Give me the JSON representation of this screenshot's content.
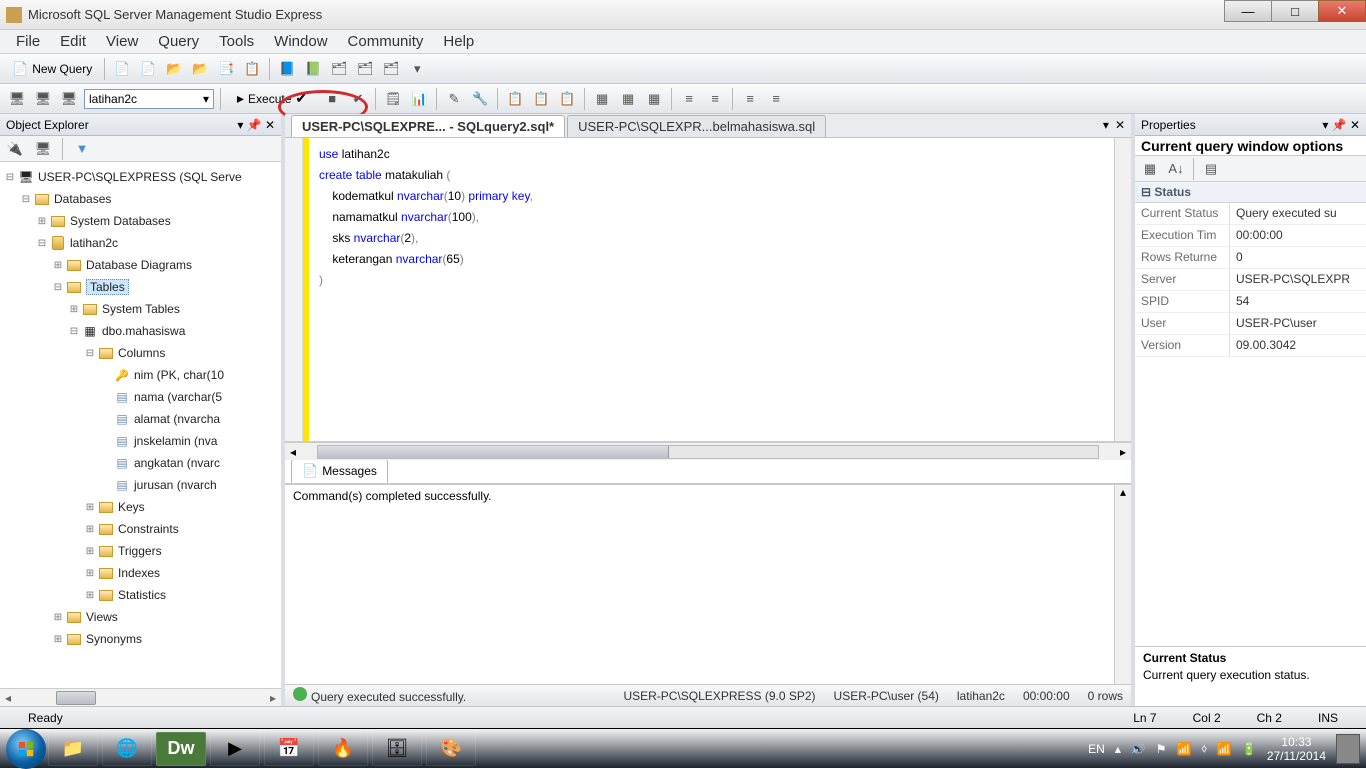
{
  "window": {
    "title": "Microsoft SQL Server Management Studio Express"
  },
  "menu": {
    "file": "File",
    "edit": "Edit",
    "view": "View",
    "query": "Query",
    "tools": "Tools",
    "window": "Window",
    "community": "Community",
    "help": "Help"
  },
  "toolbar1": {
    "newquery": "New Query"
  },
  "toolbar2": {
    "database": "latihan2c",
    "execute": "Execute"
  },
  "explorer": {
    "title": "Object Explorer",
    "server": "USER-PC\\SQLEXPRESS (SQL Serve",
    "nodes": {
      "databases": "Databases",
      "sysdb": "System Databases",
      "db": "latihan2c",
      "diagrams": "Database Diagrams",
      "tables": "Tables",
      "systables": "System Tables",
      "mahasiswa": "dbo.mahasiswa",
      "columns": "Columns",
      "col_nim": "nim (PK, char(10",
      "col_nama": "nama (varchar(5",
      "col_alamat": "alamat (nvarcha",
      "col_jnskelamin": "jnskelamin (nva",
      "col_angkatan": "angkatan (nvarc",
      "col_jurusan": "jurusan (nvarch",
      "keys": "Keys",
      "constraints": "Constraints",
      "triggers": "Triggers",
      "indexes": "Indexes",
      "statistics": "Statistics",
      "views": "Views",
      "synonyms": "Synonyms"
    }
  },
  "tabs": {
    "active": "USER-PC\\SQLEXPRE... - SQLquery2.sql*",
    "other": "USER-PC\\SQLEXPR...belmahasiswa.sql"
  },
  "code": {
    "l1a": "use",
    "l1b": " latihan2c",
    "l2a": "create",
    "l2b": " table",
    "l2c": " matakuliah ",
    "l2d": "(",
    "l3a": "    kodematkul ",
    "l3b": "nvarchar",
    "l3c": "(",
    "l3d": "10",
    "l3e": ")",
    "l3f": " primary",
    "l3g": " key",
    "l3h": ",",
    "l4a": "    namamatkul ",
    "l4b": "nvarchar",
    "l4c": "(",
    "l4d": "100",
    "l4e": ")",
    "l4f": ",",
    "l5a": "    sks ",
    "l5b": "nvarchar",
    "l5c": "(",
    "l5d": "2",
    "l5e": ")",
    "l5f": ",",
    "l6a": "    keterangan ",
    "l6b": "nvarchar",
    "l6c": "(",
    "l6d": "65",
    "l6e": ")",
    "l7": ")"
  },
  "messages": {
    "tab": "Messages",
    "text": "Command(s) completed successfully."
  },
  "querystatus": {
    "ok": "Query executed successfully.",
    "server": "USER-PC\\SQLEXPRESS (9.0 SP2)",
    "user": "USER-PC\\user (54)",
    "db": "latihan2c",
    "time": "00:00:00",
    "rows": "0 rows"
  },
  "properties": {
    "title": "Properties",
    "heading": "Current query window options",
    "cat": "Status",
    "rows": {
      "currentstatus_k": "Current Status",
      "currentstatus_v": "Query executed su",
      "exectime_k": "Execution Tim",
      "exectime_v": "00:00:00",
      "rowsret_k": "Rows Returne",
      "rowsret_v": "0",
      "server_k": "Server",
      "server_v": "USER-PC\\SQLEXPR",
      "spid_k": "SPID",
      "spid_v": "54",
      "user_k": "User",
      "user_v": "USER-PC\\user",
      "version_k": "Version",
      "version_v": "09.00.3042"
    },
    "desc_title": "Current Status",
    "desc_text": "Current query execution status."
  },
  "appstatus": {
    "ready": "Ready",
    "ln": "Ln 7",
    "col": "Col 2",
    "ch": "Ch 2",
    "ins": "INS"
  },
  "tray": {
    "lang": "EN",
    "time": "10:33",
    "date": "27/11/2014"
  }
}
